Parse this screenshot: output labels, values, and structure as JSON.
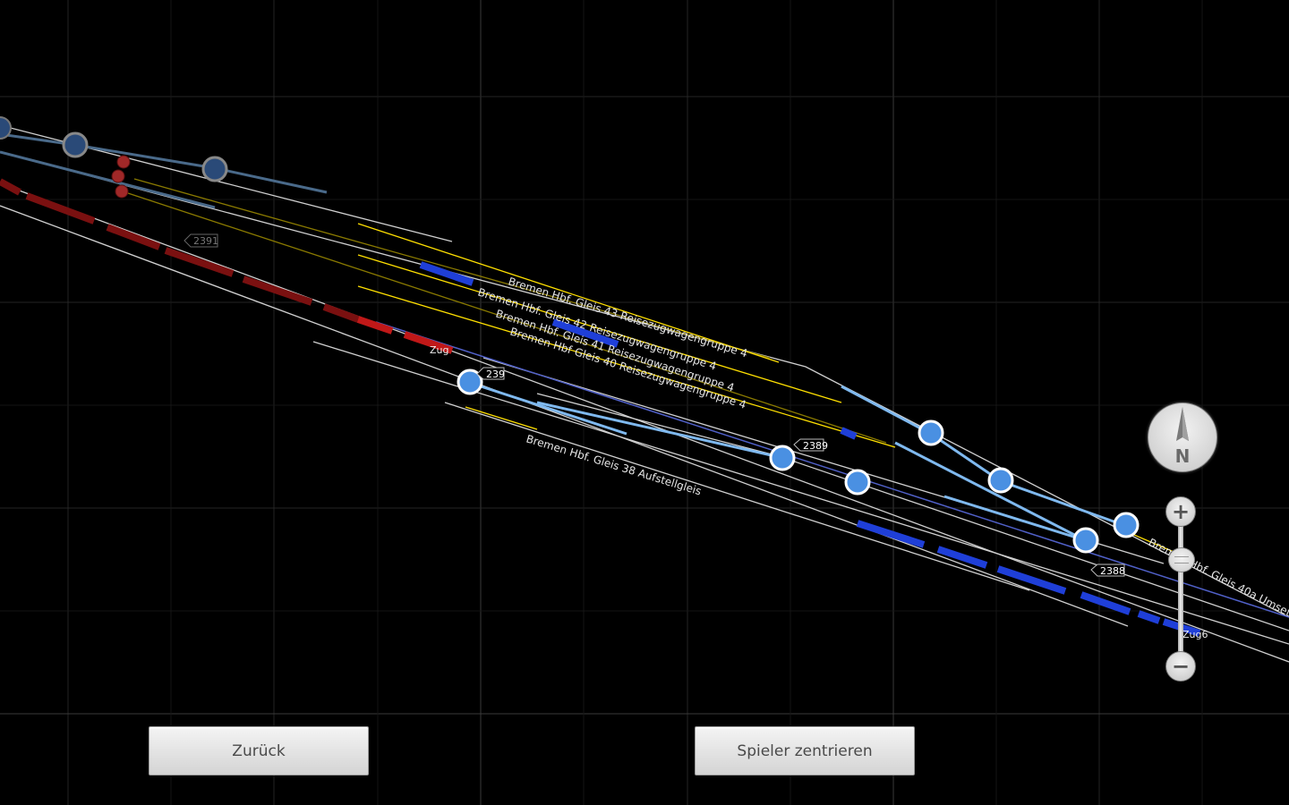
{
  "track_labels": [
    {
      "text": "Bremen Hbf. Gleis 43 Reisezugwagengruppe 4"
    },
    {
      "text": "Bremen Hbf. Gleis 42 Reisezugwagengruppe 4"
    },
    {
      "text": "Bremen Hbf. Gleis 41 Reisezugwagengruppe 4"
    },
    {
      "text": "Bremen Hbf Gleis 40 Reisezugwagengruppe 4"
    },
    {
      "text": "Bremen Hbf. Gleis 38 Aufstellgleis"
    },
    {
      "text": "Bremen Hbf. Gleis 40a Umset"
    }
  ],
  "signal_tags": [
    "2391",
    "239",
    "2389",
    "2388"
  ],
  "train_tags": [
    "Zug",
    "Zug6"
  ],
  "compass": {
    "label": "N"
  },
  "zoom": {
    "in_label": "+",
    "out_label": "−"
  },
  "buttons": {
    "back": "Zurück",
    "center": "Spieler zentrieren"
  },
  "colors": {
    "background": "#000000",
    "grid": "#2a2a2a",
    "track": "#d8d8d8",
    "platform_track": "#ffe000",
    "route": "#7fb9ef",
    "train_player": "#1f3fd8",
    "train_other": "#7a1010",
    "switch_node": "#4a90e2"
  }
}
